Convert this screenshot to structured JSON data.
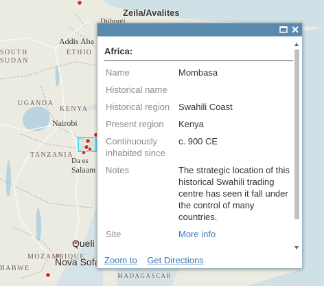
{
  "map": {
    "labels": {
      "zeila": "Zeila/Avalites",
      "djibouti": "Djibouti",
      "addis": "Addis Aba",
      "ethiopia": "ETHIO",
      "south_sudan_1": "SOUTH",
      "south_sudan_2": "SUDAN",
      "uganda": "UGANDA",
      "kenya": "KENYA",
      "nairobi": "Nairobi",
      "tanzania": "TANZANIA",
      "dar_1": "Da es",
      "dar_2": "Salaam",
      "quelimane": "Queli",
      "mozambique": "MOZAMBIQUE",
      "nova_sofala": "Nova Sofa",
      "zimbabwe": "BABWE",
      "madagascar": "MADAGASCAR"
    },
    "colors": {
      "land": "#ecebe2",
      "water": "#b9d3e1",
      "border": "#b8b4ab",
      "road": "#f7f7f3",
      "marker": "#d9331f",
      "selection": "#2fd0ef"
    }
  },
  "popup": {
    "title": "Africa:",
    "window_controls": {
      "maximize": "maximize-icon",
      "close": "close-icon"
    },
    "fields": [
      {
        "label": "Name",
        "value": "Mombasa"
      },
      {
        "label": "Historical name",
        "value": ""
      },
      {
        "label": "Historical region",
        "value": "Swahili Coast"
      },
      {
        "label": "Present region",
        "value": "Kenya"
      },
      {
        "label": "Continuously inhabited since",
        "value": "c. 900 CE"
      },
      {
        "label": "Notes",
        "value": "The strategic location of this historical Swahili trading centre has seen it fall under the control of many countries."
      },
      {
        "label": "Site",
        "value": "More info"
      }
    ],
    "actions": {
      "zoom": "Zoom to",
      "directions": "Get Directions"
    }
  }
}
